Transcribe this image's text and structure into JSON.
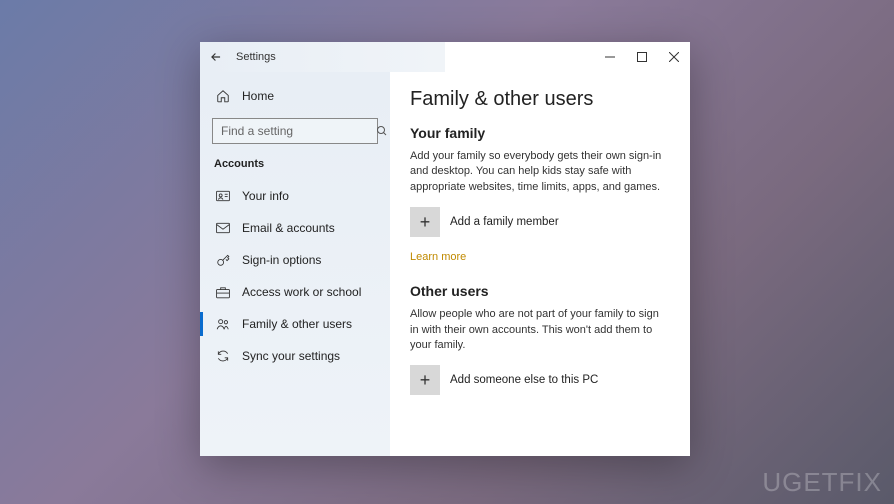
{
  "window": {
    "title": "Settings"
  },
  "sidebar": {
    "home": "Home",
    "search_placeholder": "Find a setting",
    "section": "Accounts",
    "items": [
      {
        "label": "Your info"
      },
      {
        "label": "Email & accounts"
      },
      {
        "label": "Sign-in options"
      },
      {
        "label": "Access work or school"
      },
      {
        "label": "Family & other users"
      },
      {
        "label": "Sync your settings"
      }
    ]
  },
  "main": {
    "title": "Family & other users",
    "family_heading": "Your family",
    "family_desc": "Add your family so everybody gets their own sign-in and desktop. You can help kids stay safe with appropriate websites, time limits, apps, and games.",
    "add_family_label": "Add a family member",
    "learn_more": "Learn more",
    "other_heading": "Other users",
    "other_desc": "Allow people who are not part of your family to sign in with their own accounts. This won't add them to your family.",
    "add_other_label": "Add someone else to this PC"
  },
  "watermark": "UGETFIX"
}
